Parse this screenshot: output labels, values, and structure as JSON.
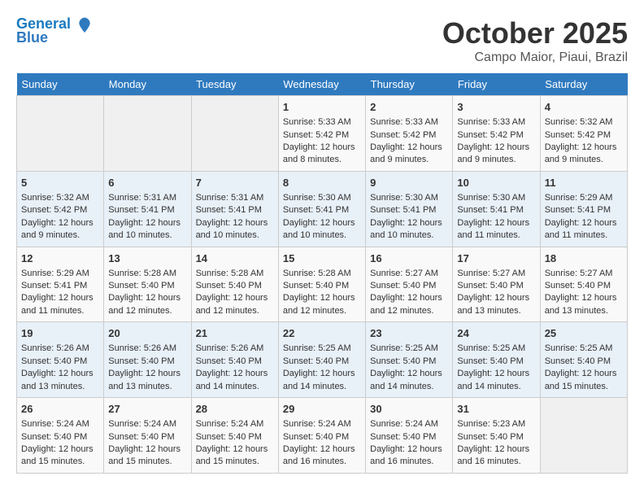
{
  "header": {
    "logo_line1": "General",
    "logo_line2": "Blue",
    "month": "October 2025",
    "location": "Campo Maior, Piaui, Brazil"
  },
  "weekdays": [
    "Sunday",
    "Monday",
    "Tuesday",
    "Wednesday",
    "Thursday",
    "Friday",
    "Saturday"
  ],
  "weeks": [
    [
      {
        "day": "",
        "sunrise": "",
        "sunset": "",
        "daylight": ""
      },
      {
        "day": "",
        "sunrise": "",
        "sunset": "",
        "daylight": ""
      },
      {
        "day": "",
        "sunrise": "",
        "sunset": "",
        "daylight": ""
      },
      {
        "day": "1",
        "sunrise": "Sunrise: 5:33 AM",
        "sunset": "Sunset: 5:42 PM",
        "daylight": "Daylight: 12 hours and 8 minutes."
      },
      {
        "day": "2",
        "sunrise": "Sunrise: 5:33 AM",
        "sunset": "Sunset: 5:42 PM",
        "daylight": "Daylight: 12 hours and 9 minutes."
      },
      {
        "day": "3",
        "sunrise": "Sunrise: 5:33 AM",
        "sunset": "Sunset: 5:42 PM",
        "daylight": "Daylight: 12 hours and 9 minutes."
      },
      {
        "day": "4",
        "sunrise": "Sunrise: 5:32 AM",
        "sunset": "Sunset: 5:42 PM",
        "daylight": "Daylight: 12 hours and 9 minutes."
      }
    ],
    [
      {
        "day": "5",
        "sunrise": "Sunrise: 5:32 AM",
        "sunset": "Sunset: 5:42 PM",
        "daylight": "Daylight: 12 hours and 9 minutes."
      },
      {
        "day": "6",
        "sunrise": "Sunrise: 5:31 AM",
        "sunset": "Sunset: 5:41 PM",
        "daylight": "Daylight: 12 hours and 10 minutes."
      },
      {
        "day": "7",
        "sunrise": "Sunrise: 5:31 AM",
        "sunset": "Sunset: 5:41 PM",
        "daylight": "Daylight: 12 hours and 10 minutes."
      },
      {
        "day": "8",
        "sunrise": "Sunrise: 5:30 AM",
        "sunset": "Sunset: 5:41 PM",
        "daylight": "Daylight: 12 hours and 10 minutes."
      },
      {
        "day": "9",
        "sunrise": "Sunrise: 5:30 AM",
        "sunset": "Sunset: 5:41 PM",
        "daylight": "Daylight: 12 hours and 10 minutes."
      },
      {
        "day": "10",
        "sunrise": "Sunrise: 5:30 AM",
        "sunset": "Sunset: 5:41 PM",
        "daylight": "Daylight: 12 hours and 11 minutes."
      },
      {
        "day": "11",
        "sunrise": "Sunrise: 5:29 AM",
        "sunset": "Sunset: 5:41 PM",
        "daylight": "Daylight: 12 hours and 11 minutes."
      }
    ],
    [
      {
        "day": "12",
        "sunrise": "Sunrise: 5:29 AM",
        "sunset": "Sunset: 5:41 PM",
        "daylight": "Daylight: 12 hours and 11 minutes."
      },
      {
        "day": "13",
        "sunrise": "Sunrise: 5:28 AM",
        "sunset": "Sunset: 5:40 PM",
        "daylight": "Daylight: 12 hours and 12 minutes."
      },
      {
        "day": "14",
        "sunrise": "Sunrise: 5:28 AM",
        "sunset": "Sunset: 5:40 PM",
        "daylight": "Daylight: 12 hours and 12 minutes."
      },
      {
        "day": "15",
        "sunrise": "Sunrise: 5:28 AM",
        "sunset": "Sunset: 5:40 PM",
        "daylight": "Daylight: 12 hours and 12 minutes."
      },
      {
        "day": "16",
        "sunrise": "Sunrise: 5:27 AM",
        "sunset": "Sunset: 5:40 PM",
        "daylight": "Daylight: 12 hours and 12 minutes."
      },
      {
        "day": "17",
        "sunrise": "Sunrise: 5:27 AM",
        "sunset": "Sunset: 5:40 PM",
        "daylight": "Daylight: 12 hours and 13 minutes."
      },
      {
        "day": "18",
        "sunrise": "Sunrise: 5:27 AM",
        "sunset": "Sunset: 5:40 PM",
        "daylight": "Daylight: 12 hours and 13 minutes."
      }
    ],
    [
      {
        "day": "19",
        "sunrise": "Sunrise: 5:26 AM",
        "sunset": "Sunset: 5:40 PM",
        "daylight": "Daylight: 12 hours and 13 minutes."
      },
      {
        "day": "20",
        "sunrise": "Sunrise: 5:26 AM",
        "sunset": "Sunset: 5:40 PM",
        "daylight": "Daylight: 12 hours and 13 minutes."
      },
      {
        "day": "21",
        "sunrise": "Sunrise: 5:26 AM",
        "sunset": "Sunset: 5:40 PM",
        "daylight": "Daylight: 12 hours and 14 minutes."
      },
      {
        "day": "22",
        "sunrise": "Sunrise: 5:25 AM",
        "sunset": "Sunset: 5:40 PM",
        "daylight": "Daylight: 12 hours and 14 minutes."
      },
      {
        "day": "23",
        "sunrise": "Sunrise: 5:25 AM",
        "sunset": "Sunset: 5:40 PM",
        "daylight": "Daylight: 12 hours and 14 minutes."
      },
      {
        "day": "24",
        "sunrise": "Sunrise: 5:25 AM",
        "sunset": "Sunset: 5:40 PM",
        "daylight": "Daylight: 12 hours and 14 minutes."
      },
      {
        "day": "25",
        "sunrise": "Sunrise: 5:25 AM",
        "sunset": "Sunset: 5:40 PM",
        "daylight": "Daylight: 12 hours and 15 minutes."
      }
    ],
    [
      {
        "day": "26",
        "sunrise": "Sunrise: 5:24 AM",
        "sunset": "Sunset: 5:40 PM",
        "daylight": "Daylight: 12 hours and 15 minutes."
      },
      {
        "day": "27",
        "sunrise": "Sunrise: 5:24 AM",
        "sunset": "Sunset: 5:40 PM",
        "daylight": "Daylight: 12 hours and 15 minutes."
      },
      {
        "day": "28",
        "sunrise": "Sunrise: 5:24 AM",
        "sunset": "Sunset: 5:40 PM",
        "daylight": "Daylight: 12 hours and 15 minutes."
      },
      {
        "day": "29",
        "sunrise": "Sunrise: 5:24 AM",
        "sunset": "Sunset: 5:40 PM",
        "daylight": "Daylight: 12 hours and 16 minutes."
      },
      {
        "day": "30",
        "sunrise": "Sunrise: 5:24 AM",
        "sunset": "Sunset: 5:40 PM",
        "daylight": "Daylight: 12 hours and 16 minutes."
      },
      {
        "day": "31",
        "sunrise": "Sunrise: 5:23 AM",
        "sunset": "Sunset: 5:40 PM",
        "daylight": "Daylight: 12 hours and 16 minutes."
      },
      {
        "day": "",
        "sunrise": "",
        "sunset": "",
        "daylight": ""
      }
    ]
  ]
}
